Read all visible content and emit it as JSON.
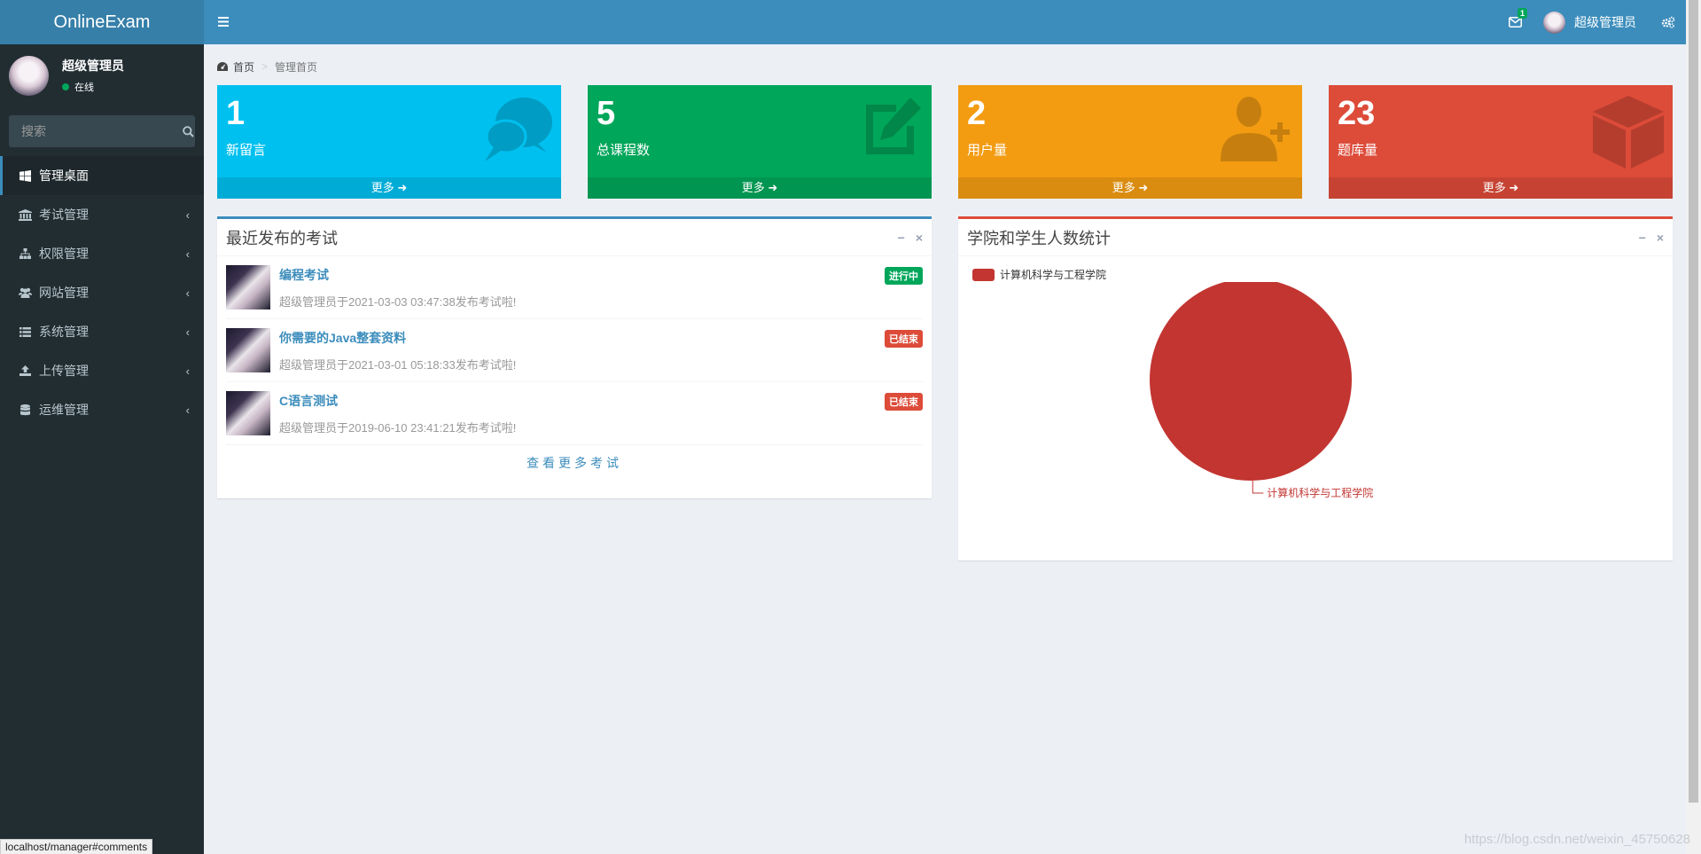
{
  "header": {
    "logo": "OnlineExam",
    "mail_badge": "1",
    "user_name": "超级管理员"
  },
  "sidebar": {
    "user_name": "超级管理员",
    "status": "在线",
    "search_placeholder": "搜索",
    "items": [
      {
        "label": "管理桌面",
        "icon": "windows-icon",
        "active": true
      },
      {
        "label": "考试管理",
        "icon": "bank-icon"
      },
      {
        "label": "权限管理",
        "icon": "sitemap-icon"
      },
      {
        "label": "网站管理",
        "icon": "users-icon"
      },
      {
        "label": "系统管理",
        "icon": "list-icon"
      },
      {
        "label": "上传管理",
        "icon": "upload-icon"
      },
      {
        "label": "运维管理",
        "icon": "database-icon"
      }
    ]
  },
  "breadcrumb": {
    "home": "首页",
    "current": "管理首页"
  },
  "stats": [
    {
      "value": "1",
      "label": "新留言",
      "more": "更多",
      "color": "#00c0ef",
      "icon": "comments-icon"
    },
    {
      "value": "5",
      "label": "总课程数",
      "more": "更多",
      "color": "#00a65a",
      "icon": "edit-icon"
    },
    {
      "value": "2",
      "label": "用户量",
      "more": "更多",
      "color": "#f39c12",
      "icon": "user-plus-icon"
    },
    {
      "value": "23",
      "label": "题库量",
      "more": "更多",
      "color": "#dd4b39",
      "icon": "cube-icon"
    }
  ],
  "exams": {
    "title": "最近发布的考试",
    "items": [
      {
        "name": "编程考试",
        "desc": "超级管理员于2021-03-03 03:47:38发布考试啦!",
        "status": "进行中",
        "status_color": "#00a65a"
      },
      {
        "name": "你需要的Java整套资料",
        "desc": "超级管理员于2021-03-01 05:18:33发布考试啦!",
        "status": "已结束",
        "status_color": "#dd4b39"
      },
      {
        "name": "C语言测试",
        "desc": "超级管理员于2019-06-10 23:41:21发布考试啦!",
        "status": "已结束",
        "status_color": "#dd4b39"
      }
    ],
    "more": "查看更多考试"
  },
  "stats_panel": {
    "title": "学院和学生人数统计"
  },
  "chart_data": {
    "type": "pie",
    "title": "",
    "categories": [
      "计算机科学与工程学院"
    ],
    "values": [
      1
    ],
    "colors": [
      "#c23531"
    ],
    "legend": "top-left"
  },
  "status_url": "localhost/manager#comments",
  "watermark": "https://blog.csdn.net/weixin_45750628"
}
